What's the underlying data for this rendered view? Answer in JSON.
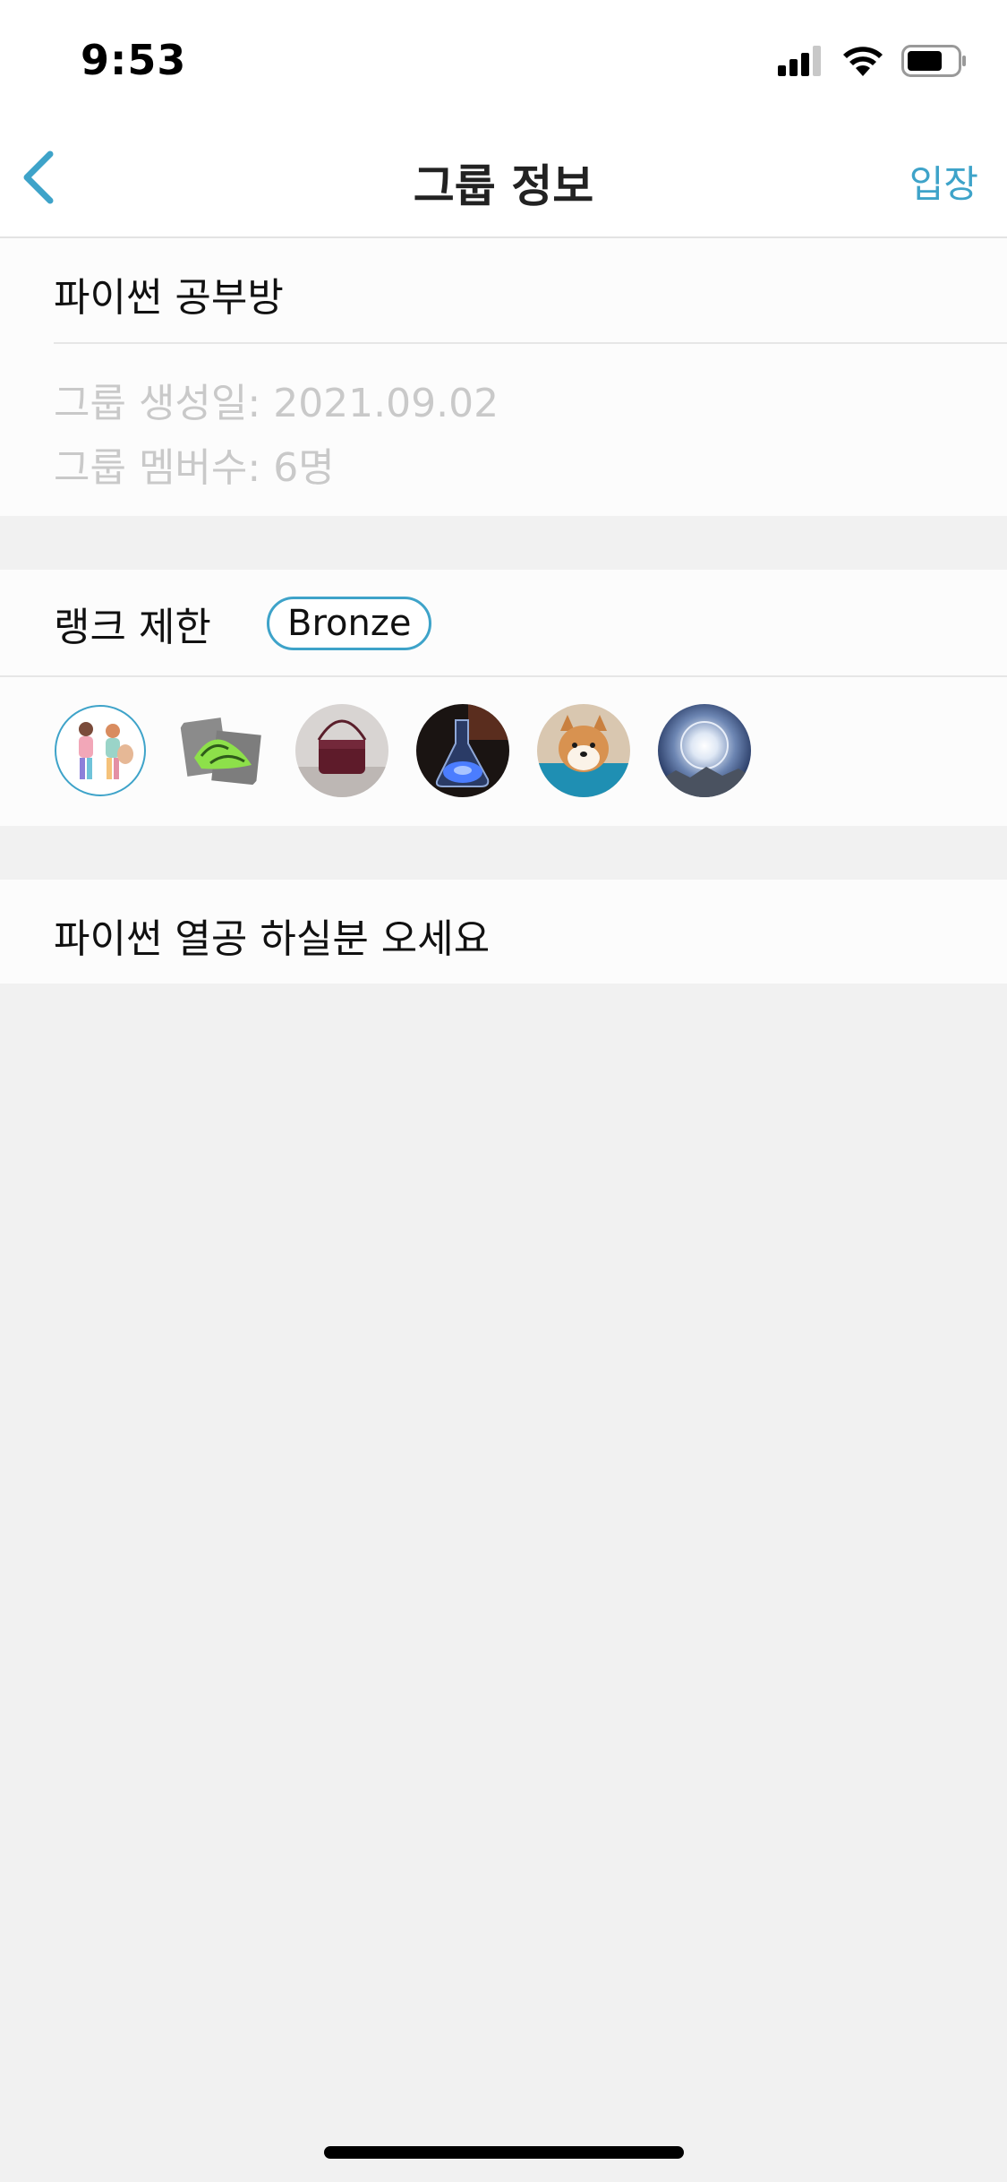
{
  "status_bar": {
    "time": "9:53"
  },
  "nav": {
    "title": "그룹 정보",
    "enter_label": "입장"
  },
  "group_info": {
    "name": "파이썬 공부방",
    "created": "그룹 생성일: 2021.09.02",
    "members": "그룹 멤버수: 6명"
  },
  "rank": {
    "label": "랭크 제한",
    "badge": "Bronze"
  },
  "avatars": [
    {
      "name": "member-avatar-illustration"
    },
    {
      "name": "member-avatar-sneakers"
    },
    {
      "name": "member-avatar-bag"
    },
    {
      "name": "member-avatar-flask"
    },
    {
      "name": "member-avatar-shiba"
    },
    {
      "name": "member-avatar-sun-halo"
    }
  ],
  "description": "파이썬 열공 하실분 오세요",
  "colors": {
    "accent": "#3ea3c9",
    "background": "#f1f1f1",
    "section": "#fcfcfc",
    "muted_text": "#c9c9c9"
  }
}
